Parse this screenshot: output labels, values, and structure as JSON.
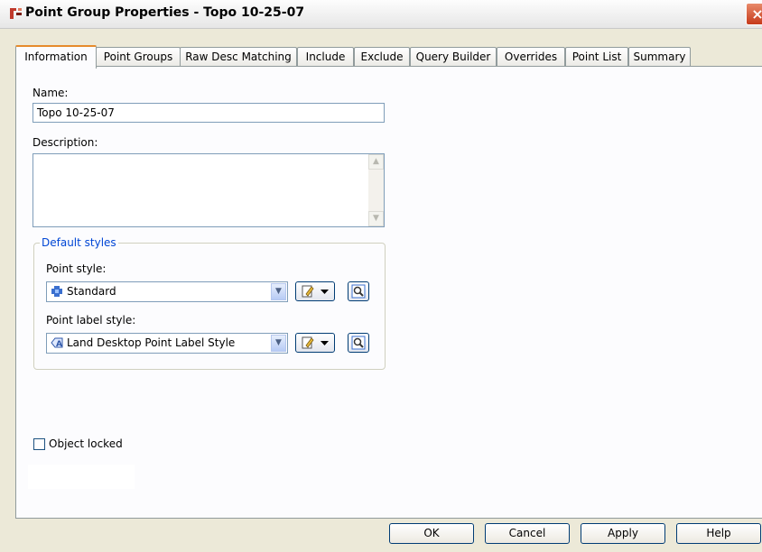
{
  "window": {
    "title": "Point Group Properties - Topo 10-25-07",
    "close_glyph": "×"
  },
  "tabs": [
    {
      "label": "Information",
      "active": true
    },
    {
      "label": "Point Groups"
    },
    {
      "label": "Raw Desc Matching"
    },
    {
      "label": "Include"
    },
    {
      "label": "Exclude"
    },
    {
      "label": "Query Builder"
    },
    {
      "label": "Overrides"
    },
    {
      "label": "Point List"
    },
    {
      "label": "Summary"
    }
  ],
  "info": {
    "name_label": "Name:",
    "name_value": "Topo 10-25-07",
    "description_label": "Description:",
    "description_value": ""
  },
  "default_styles": {
    "title": "Default styles",
    "point_style_label": "Point style:",
    "point_style_value": "Standard",
    "point_style_icon": "point-style-icon",
    "point_label_style_label": "Point label style:",
    "point_label_style_value": "Land Desktop Point Label Style",
    "point_label_style_icon": "label-style-icon"
  },
  "object_locked": {
    "label": "Object locked",
    "checked": false
  },
  "buttons": {
    "ok": "OK",
    "cancel": "Cancel",
    "apply": "Apply",
    "help": "Help"
  }
}
